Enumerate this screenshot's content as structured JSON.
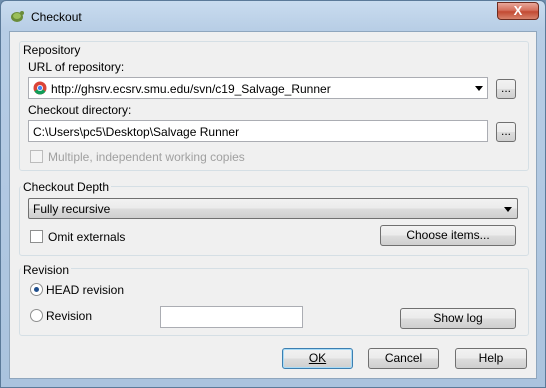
{
  "window": {
    "title": "Checkout",
    "close_glyph": "X"
  },
  "repository": {
    "group_title": "Repository",
    "url_label": "URL of repository:",
    "url_value": "http://ghsrv.ecsrv.smu.edu/svn/c19_Salvage_Runner",
    "browse_url_label": "...",
    "dir_label": "Checkout directory:",
    "dir_value": "C:\\Users\\pc5\\Desktop\\Salvage Runner",
    "browse_dir_label": "...",
    "multiple_label": "Multiple, independent working copies",
    "multiple_checked": false,
    "multiple_enabled": false
  },
  "depth": {
    "group_title": "Checkout Depth",
    "selected": "Fully recursive",
    "omit_externals_label": "Omit externals",
    "omit_externals_checked": false,
    "choose_items_label": "Choose items..."
  },
  "revision": {
    "group_title": "Revision",
    "head_label": "HEAD revision",
    "head_selected": true,
    "revision_label": "Revision",
    "revision_value": "",
    "show_log_label": "Show log"
  },
  "buttons": {
    "ok": "OK",
    "cancel": "Cancel",
    "help": "Help"
  },
  "icons": {
    "app": "tortoise-svn-icon",
    "url": "chrome-icon"
  }
}
